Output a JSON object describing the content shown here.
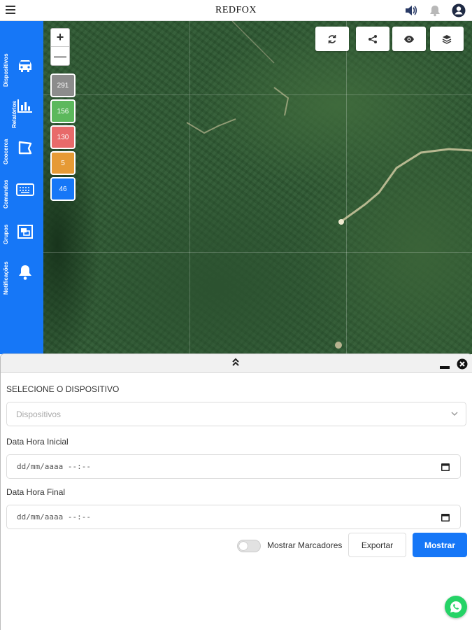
{
  "header": {
    "title": "REDFOX",
    "icons": [
      "menu-icon",
      "volume-icon",
      "bell-icon",
      "user-icon"
    ]
  },
  "sidebar": {
    "items": [
      {
        "label": "Dispositivos",
        "icon": "car-icon"
      },
      {
        "label": "Relatórios",
        "icon": "bar-chart-icon"
      },
      {
        "label": "Geocerca",
        "icon": "geofence-icon"
      },
      {
        "label": "Comandos",
        "icon": "keyboard-icon"
      },
      {
        "label": "Grupos",
        "icon": "group-icon"
      },
      {
        "label": "Notificações",
        "icon": "bell-icon"
      }
    ],
    "color": "#1677f7"
  },
  "map": {
    "zoom_in": "+",
    "zoom_out": "—",
    "badges": [
      {
        "value": "291",
        "color": "#8c8c8c"
      },
      {
        "value": "156",
        "color": "#5cb85c"
      },
      {
        "value": "130",
        "color": "#e86a6a"
      },
      {
        "value": "5",
        "color": "#e69a35"
      },
      {
        "value": "46",
        "color": "#1677f7"
      }
    ],
    "tools": [
      "refresh-icon",
      "share-icon",
      "eye-icon",
      "layers-icon"
    ]
  },
  "panel": {
    "device_label": "SELECIONE O DISPOSITIVO",
    "device_placeholder": "Dispositivos",
    "start_label": "Data Hora Inicial",
    "start_placeholder": "dd/mm/aaaa --:--",
    "end_label": "Data Hora Final",
    "end_placeholder": "dd/mm/aaaa --:--",
    "toggle_label": "Mostrar Marcadores",
    "export_label": "Exportar",
    "show_label": "Mostrar"
  },
  "colors": {
    "accent": "#1677f7",
    "whatsapp": "#25d366"
  }
}
